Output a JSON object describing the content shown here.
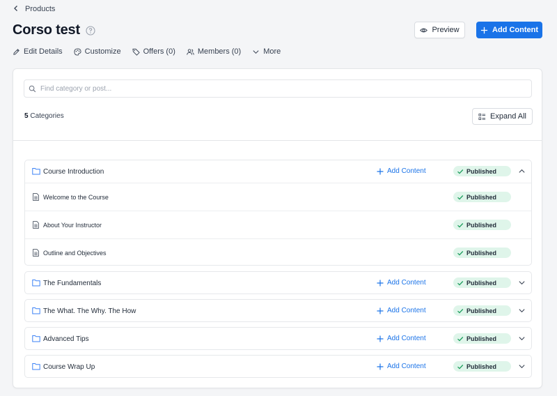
{
  "breadcrumb": {
    "label": "Products"
  },
  "title": "Corso test",
  "buttons": {
    "preview": "Preview",
    "add_content": "Add Content",
    "expand_all": "Expand All"
  },
  "tabs": [
    {
      "label": "Edit Details",
      "icon": "pencil-icon"
    },
    {
      "label": "Customize",
      "icon": "palette-icon"
    },
    {
      "label": "Offers (0)",
      "icon": "tag-icon"
    },
    {
      "label": "Members (0)",
      "icon": "users-icon"
    },
    {
      "label": "More",
      "icon": "chevron-down-icon"
    }
  ],
  "search": {
    "placeholder": "Find category or post...",
    "value": ""
  },
  "category_count": {
    "number": "5",
    "label": "Categories"
  },
  "colors": {
    "accent": "#1a73e8",
    "badge_bg": "#dff5ea",
    "badge_check": "#1e9e5e"
  },
  "categories": [
    {
      "name": "Course Introduction",
      "add_label": "Add Content",
      "status": "Published",
      "expanded": true,
      "posts": [
        {
          "name": "Welcome to the Course",
          "status": "Published"
        },
        {
          "name": "About Your Instructor",
          "status": "Published"
        },
        {
          "name": "Outline and Objectives",
          "status": "Published"
        }
      ]
    },
    {
      "name": "The Fundamentals",
      "add_label": "Add Content",
      "status": "Published",
      "expanded": false
    },
    {
      "name": "The What. The Why. The How",
      "add_label": "Add Content",
      "status": "Published",
      "expanded": false
    },
    {
      "name": "Advanced Tips",
      "add_label": "Add Content",
      "status": "Published",
      "expanded": false
    },
    {
      "name": "Course Wrap Up",
      "add_label": "Add Content",
      "status": "Published",
      "expanded": false
    }
  ]
}
